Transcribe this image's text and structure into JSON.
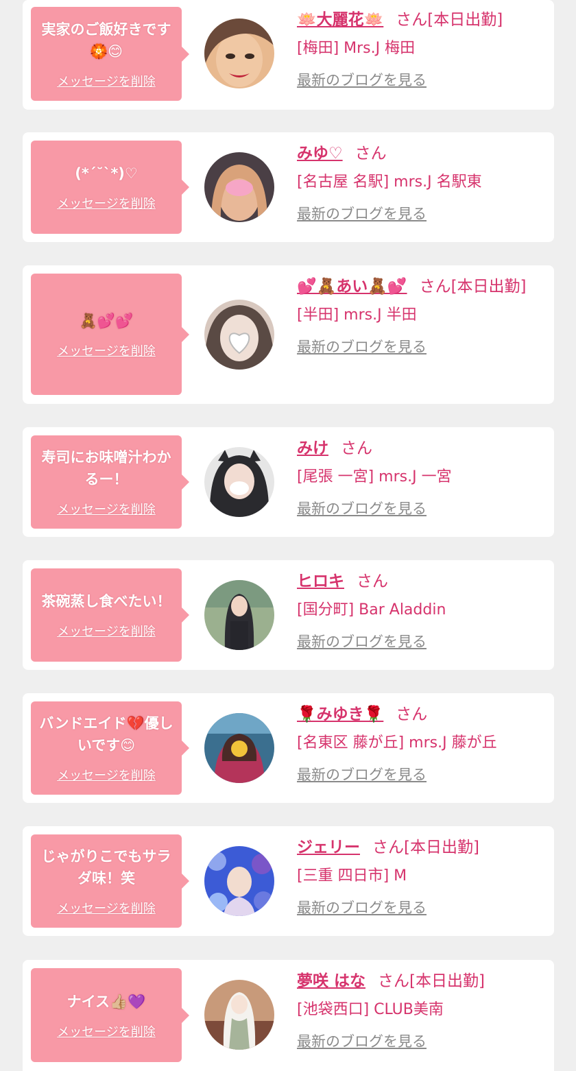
{
  "colors": {
    "accent": "#d6336c",
    "bubble": "#f899a6",
    "muted": "#8a8a8a",
    "bg": "#efefef"
  },
  "cards": [
    {
      "message": "実家のご飯好きです🏵️😊",
      "delete_label": "メッセージを削除",
      "name": "🪷大麗花🪷",
      "suffix": "さん[本日出勤]",
      "shop": "[梅田] Mrs.J 梅田",
      "blog_label": "最新のブログを見る",
      "avatar_colors": [
        "#e8b98f",
        "#6b4a3a"
      ]
    },
    {
      "message": "(*´˘`*)♡",
      "delete_label": "メッセージを削除",
      "name": "みゆ♡",
      "suffix": "さん",
      "shop": "[名古屋 名駅] mrs.J 名駅東",
      "blog_label": "最新のブログを見る",
      "avatar_colors": [
        "#d9a27a",
        "#4a3f45"
      ]
    },
    {
      "message": "🧸💕💕",
      "delete_label": "メッセージを削除",
      "name": "💕🧸あい🧸💕",
      "suffix": "さん[本日出勤]",
      "shop": "[半田] mrs.J 半田",
      "blog_label": "最新のブログを見る",
      "avatar_colors": [
        "#d8c8bf",
        "#5a4a44"
      ]
    },
    {
      "message": "寿司にお味噌汁わかるー！",
      "delete_label": "メッセージを削除",
      "name": "みけ",
      "suffix": "さん",
      "shop": "[尾張 一宮] mrs.J 一宮",
      "blog_label": "最新のブログを見る",
      "avatar_colors": [
        "#e6e6e6",
        "#2a2a2e"
      ]
    },
    {
      "message": "茶碗蒸し食べたい！",
      "delete_label": "メッセージを削除",
      "name": "ヒロキ",
      "suffix": "さん",
      "shop": "[国分町] Bar Aladdin",
      "blog_label": "最新のブログを見る",
      "avatar_colors": [
        "#9bb08f",
        "#2c2c32"
      ]
    },
    {
      "message": "バンドエイド💔優しいです😊",
      "delete_label": "メッセージを削除",
      "name": "🌹みゆき🌹",
      "suffix": "さん",
      "shop": "[名東区 藤が丘] mrs.J 藤が丘",
      "blog_label": "最新のブログを見る",
      "avatar_colors": [
        "#3b6f8f",
        "#b4345a"
      ]
    },
    {
      "message": "じゃがりこでもサラダ味！笑",
      "delete_label": "メッセージを削除",
      "name": "ジェリー",
      "suffix": "さん[本日出勤]",
      "shop": "[三重 四日市] M",
      "blog_label": "最新のブログを見る",
      "avatar_colors": [
        "#3c5bd6",
        "#e2d6ef"
      ]
    },
    {
      "message": "ナイス👍🏼💜",
      "delete_label": "メッセージを削除",
      "name": "夢咲 はな",
      "suffix": "さん[本日出勤]",
      "shop": "[池袋西口] CLUB美南",
      "blog_label": "最新のブログを見る",
      "avatar_colors": [
        "#c89a7a",
        "#7d4b3a"
      ]
    }
  ]
}
